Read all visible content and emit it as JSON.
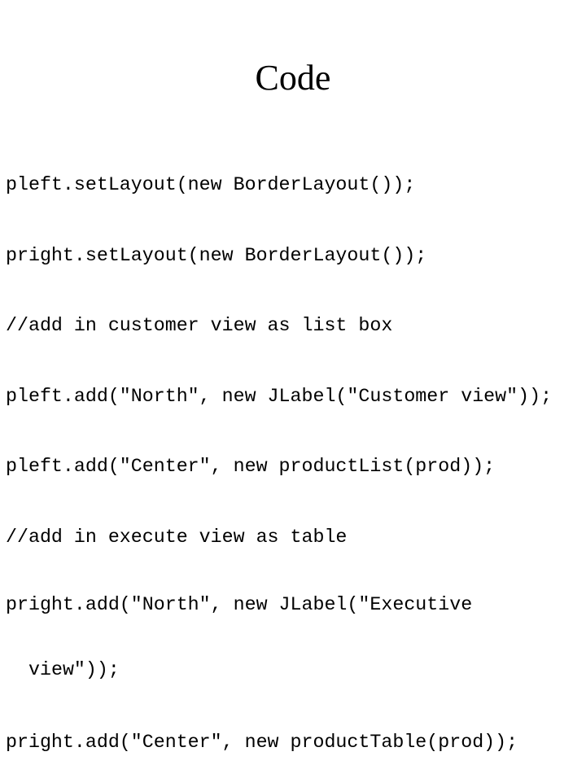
{
  "slide": {
    "title": "Code",
    "code_lines": [
      "pleft.setLayout(new BorderLayout());",
      "pright.setLayout(new BorderLayout());",
      "//add in customer view as list box",
      "pleft.add(\"North\", new JLabel(\"Customer view\"));",
      "pleft.add(\"Center\", new productList(prod));",
      "//add in execute view as table",
      "pright.add(\"North\", new JLabel(\"Executive",
      "view\"));",
      "pright.add(\"Center\", new productTable(prod));"
    ]
  }
}
